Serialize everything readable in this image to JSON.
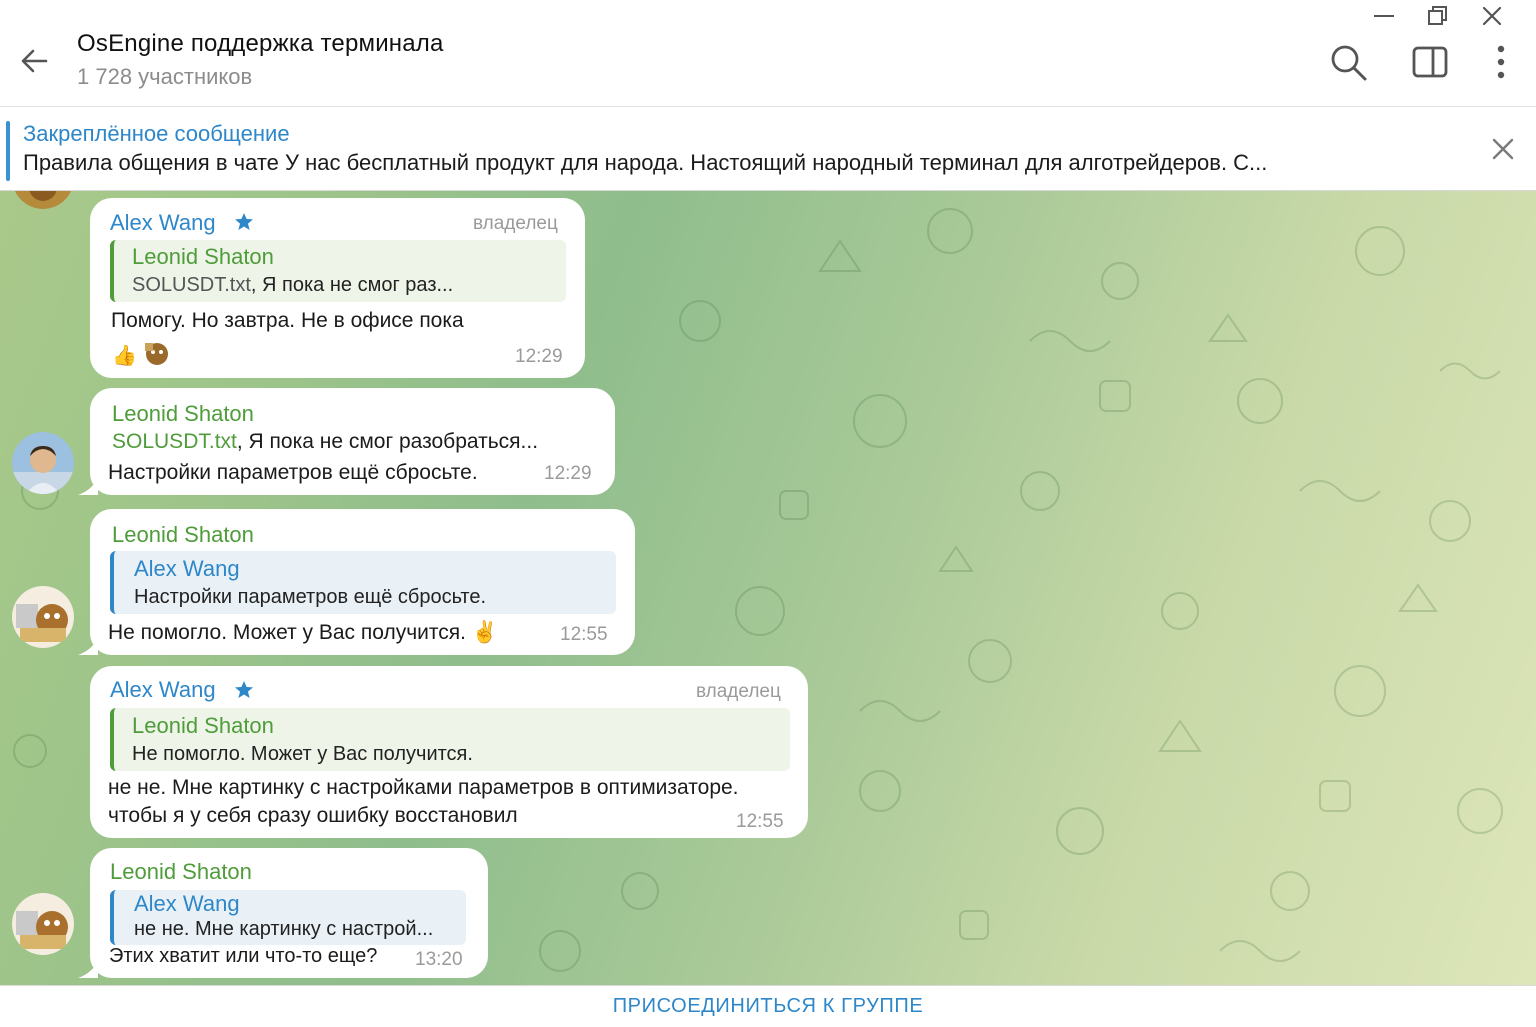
{
  "header": {
    "title": "OsEngine поддержка терминала",
    "subtitle": "1 728 участников"
  },
  "pinned": {
    "title": "Закреплённое сообщение",
    "text": "Правила общения в чате  У нас бесплатный продукт для народа. Настоящий народный терминал для алготрейдеров. С..."
  },
  "messages": [
    {
      "sender": "Alex Wang",
      "badge": "владелец",
      "reply_name": "Leonid Shaton",
      "reply_file": "SOLUSDT.txt",
      "reply_text": ", Я пока не смог раз...",
      "text": "Помогу. Но завтра. Не в офисе пока",
      "reactions": "👍",
      "time": "12:29"
    },
    {
      "sender": "Leonid Shaton",
      "file": "SOLUSDT.txt",
      "file_suffix": ", Я пока не смог разобраться...",
      "text": "Настройки параметров ещё сбросьте.",
      "time": "12:29"
    },
    {
      "sender": "Leonid Shaton",
      "reply_name": "Alex Wang",
      "reply_text": "Настройки параметров ещё сбросьте.",
      "text": "Не помогло. Может у Вас получится. ✌️",
      "time": "12:55"
    },
    {
      "sender": "Alex Wang",
      "badge": "владелец",
      "reply_name": "Leonid Shaton",
      "reply_text": "Не помогло. Может у Вас получится.",
      "line1": "не не. Мне картинку с настройками параметров в оптимизаторе.",
      "line2": "чтобы я у себя сразу ошибку восстановил",
      "time": "12:55"
    },
    {
      "sender": "Leonid Shaton",
      "reply_name": "Alex Wang",
      "reply_text": "не не. Мне картинку с настрой...",
      "text": "Этих хватит или что-то еще?",
      "time": "13:20"
    }
  ],
  "bottom": {
    "join_label": "ПРИСОЕДИНИТЬСЯ К ГРУППЕ"
  },
  "colors": {
    "accent_blue": "#2e87c9",
    "leonid_green": "#4f9c3b",
    "muted_gray": "#9a9a9a"
  }
}
